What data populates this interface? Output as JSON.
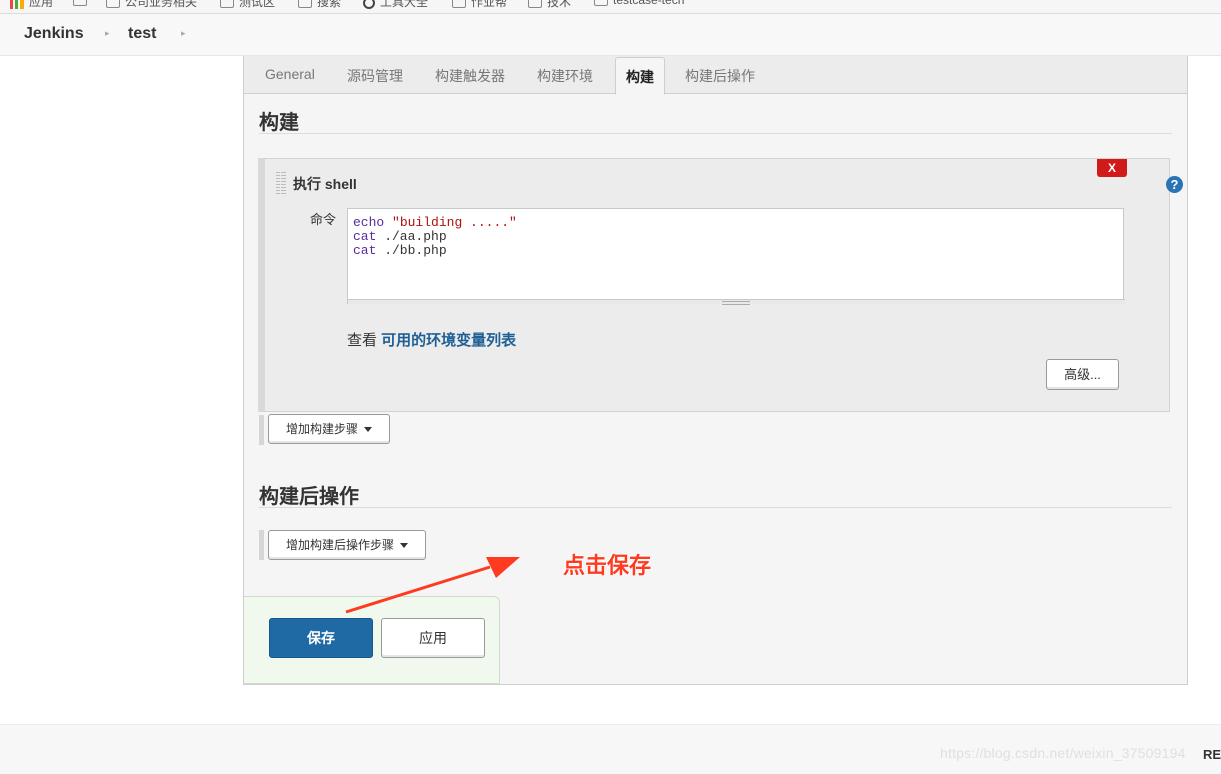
{
  "bookmarks": [
    {
      "icon": "apps-icon",
      "label": "应用"
    },
    {
      "icon": "folder-icon",
      "label": ""
    },
    {
      "icon": "folder-icon",
      "label": "公司业务相关"
    },
    {
      "icon": "folder-icon",
      "label": "测试区"
    },
    {
      "icon": "folder-icon",
      "label": "搜索"
    },
    {
      "icon": "globe-icon",
      "label": "工具大全"
    },
    {
      "icon": "folder-icon",
      "label": "作业帮"
    },
    {
      "icon": "folder-icon",
      "label": "技术"
    },
    {
      "icon": "folder-icon",
      "label": "testcase-tech"
    }
  ],
  "breadcrumb": {
    "items": [
      "Jenkins",
      "test"
    ]
  },
  "tabs": [
    "General",
    "源码管理",
    "构建触发器",
    "构建环境",
    "构建",
    "构建后操作"
  ],
  "active_tab": "构建",
  "build_section": {
    "title": "构建",
    "step": {
      "title": "执行 shell",
      "close_label": "X",
      "help_label": "?",
      "command_label": "命令",
      "command_lines": [
        {
          "kw": "echo",
          "rest": " ",
          "str": "\"building .....\""
        },
        {
          "kw": "cat",
          "rest": " ./aa.php",
          "str": ""
        },
        {
          "kw": "cat",
          "rest": " ./bb.php",
          "str": ""
        }
      ],
      "env_prefix": "查看 ",
      "env_link": "可用的环境变量列表",
      "advanced_label": "高级..."
    },
    "add_step_label": "增加构建步骤"
  },
  "post_build_section": {
    "title": "构建后操作",
    "add_step_label": "增加构建后操作步骤"
  },
  "actions": {
    "save_label": "保存",
    "apply_label": "应用"
  },
  "annotation": {
    "text": "点击保存",
    "color": "#ff3a1e"
  },
  "footer": {
    "watermark": "https://blog.csdn.net/weixin_37509194",
    "edge_text": "RE"
  },
  "colors": {
    "primary_button": "#1f6aa4",
    "link": "#1f5f95",
    "close_button": "#d11a1a"
  }
}
